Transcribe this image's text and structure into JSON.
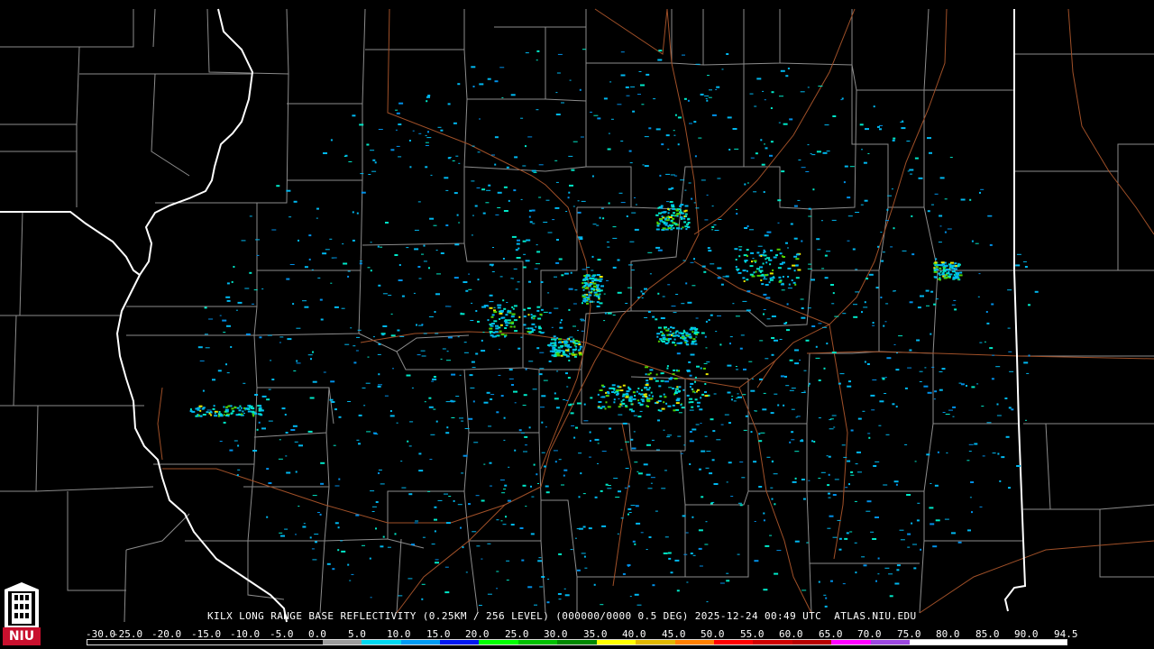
{
  "caption": "KILX LONG RANGE BASE REFLECTIVITY (0.25KM / 256 LEVEL) (000000/0000 0.5 DEG) 2025-12-24 00:49 UTC  ATLAS.NIU.EDU",
  "logo": {
    "text": "NIU",
    "icon": "niu-tower-logo-icon"
  },
  "scale": {
    "labels": [
      "-30.0",
      "-25.0",
      "-20.0",
      "-15.0",
      "-10.0",
      "-5.0",
      "0.0",
      "5.0",
      "10.0",
      "15.0",
      "20.0",
      "25.0",
      "30.0",
      "35.0",
      "40.0",
      "45.0",
      "50.0",
      "55.0",
      "60.0",
      "65.0",
      "70.0",
      "75.0",
      "80.0",
      "85.0",
      "90.0",
      "94.5"
    ],
    "colors": [
      "#000000",
      "#000000",
      "#000000",
      "#000000",
      "#000000",
      "#000000",
      "#9c9c9c",
      "#00d8f0",
      "#009cf4",
      "#0018f0",
      "#00ff00",
      "#00c000",
      "#008800",
      "#ffff00",
      "#e0b800",
      "#ff8000",
      "#ff0000",
      "#d00000",
      "#b80000",
      "#ff00ff",
      "#9c48e0",
      "#ffffff",
      "#ffffff",
      "#ffffff",
      "#ffffff"
    ]
  },
  "colors": {
    "state_border": "#ffffff",
    "county_border": "#8c8c8c",
    "highway": "#a05028",
    "echo_light": "#00b8f0",
    "echo_mid": "#00e8c8",
    "echo_strong": "#50d000",
    "echo_core": "#e8e800"
  }
}
